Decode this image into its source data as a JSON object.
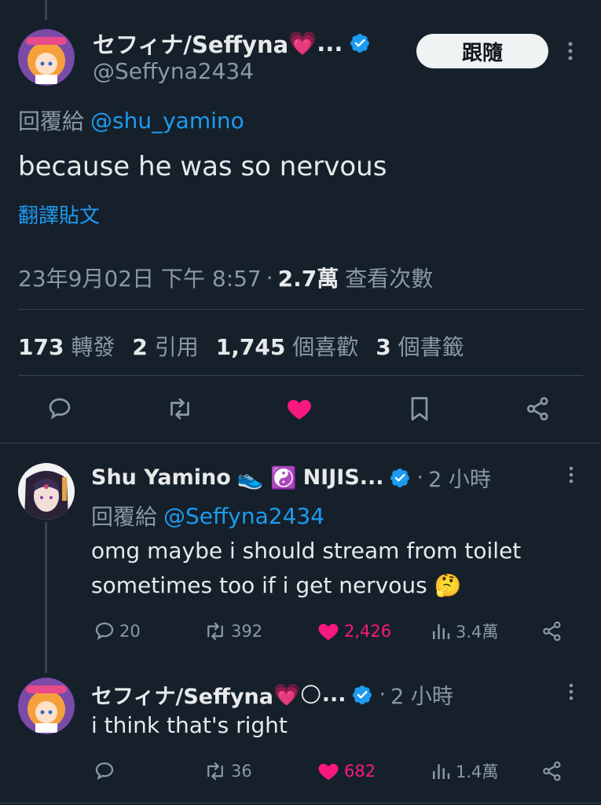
{
  "main_tweet": {
    "display_name": "セフィナ/Seffyna",
    "heart_emoji": "💗",
    "ellipsis": "...",
    "handle": "@Seffyna2434",
    "follow_label": "跟隨",
    "reply_prefix": "回覆給",
    "reply_to": "@shu_yamino",
    "text": "because he was so nervous",
    "translate_label": "翻譯貼文",
    "timestamp": "23年9月02日 下午 8:57",
    "sep": "·",
    "views_count": "2.7萬",
    "views_label": "查看次數",
    "stats": [
      {
        "num": "173",
        "label": "轉發"
      },
      {
        "num": "2",
        "label": "引用"
      },
      {
        "num": "1,745",
        "label": "個喜歡"
      },
      {
        "num": "3",
        "label": "個書籤"
      }
    ],
    "liked_color": "#f91880"
  },
  "reply1": {
    "display_name": "Shu Yamino",
    "emojis": "👟 ☯️",
    "name_suffix": "NIJIS...",
    "time_sep": "·",
    "time": "2 小時",
    "reply_prefix": "回覆給",
    "reply_to": "@Seffyna2434",
    "text_line1": "omg maybe i should stream from toilet",
    "text_line2": "sometimes too if i get nervous 🤔",
    "replies": "20",
    "retweets": "392",
    "likes": "2,426",
    "views": "3.4萬"
  },
  "reply2": {
    "display_name": "セフィナ/Seffyna",
    "emojis": "💗🌕",
    "ellipsis": "...",
    "time_sep": "·",
    "time": "2 小時",
    "text": "i think that's right",
    "replies": "",
    "retweets": "36",
    "likes": "682",
    "views": "1.4萬"
  }
}
